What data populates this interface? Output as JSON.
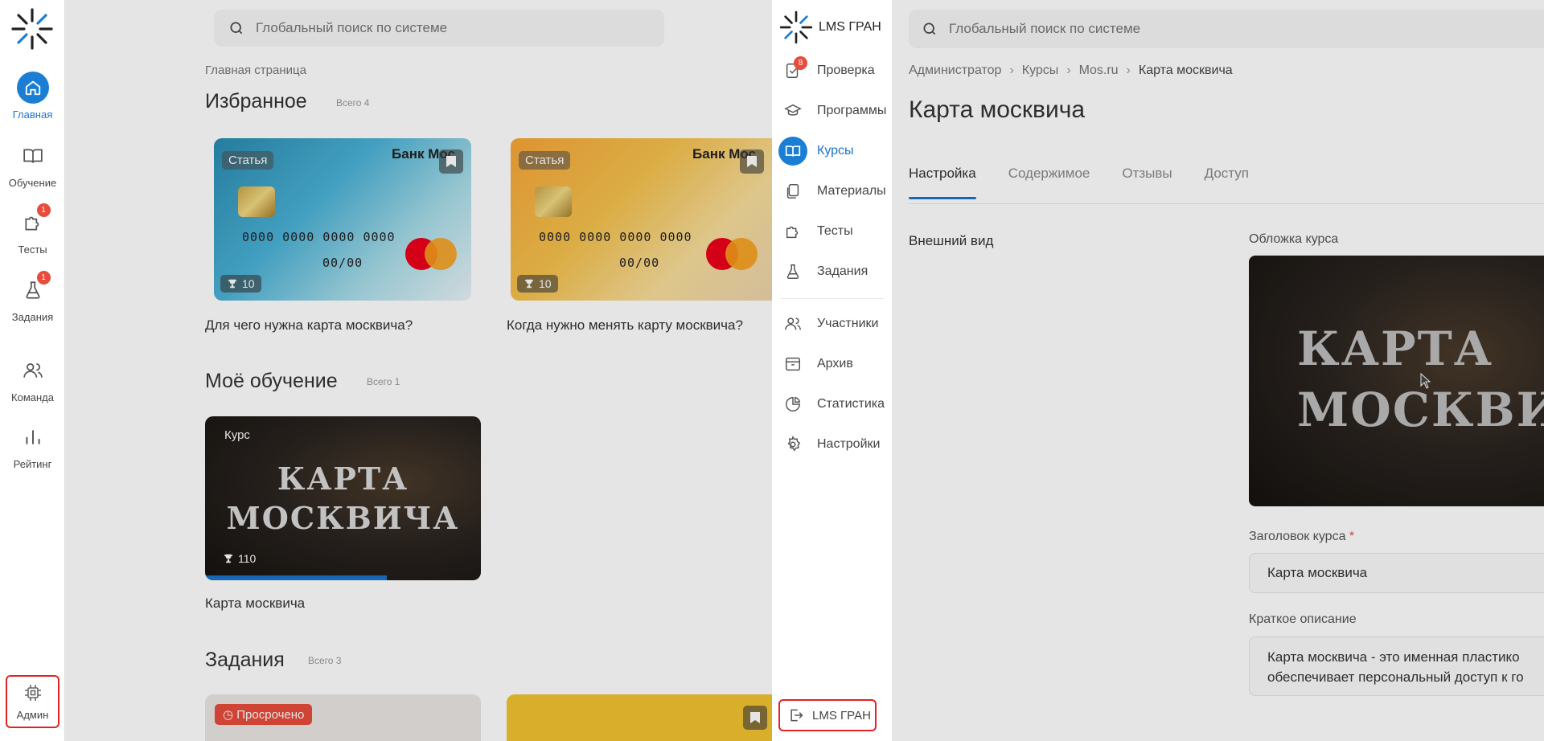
{
  "left": {
    "search_placeholder": "Глобальный поиск по системе",
    "breadcrumb": "Главная страница",
    "nav": [
      {
        "label": "Главная",
        "badge": ""
      },
      {
        "label": "Обучение",
        "badge": ""
      },
      {
        "label": "Тесты",
        "badge": "1"
      },
      {
        "label": "Задания",
        "badge": "1"
      },
      {
        "label": "Команда",
        "badge": ""
      },
      {
        "label": "Рейтинг",
        "badge": ""
      }
    ],
    "admin_label": "Админ",
    "favorites": {
      "title": "Избранное",
      "count": "Всего 4",
      "cards": [
        {
          "tag": "Статья",
          "score": "10",
          "caption": "Для чего нужна карта москвича?",
          "bank": "Банк Мос",
          "number": "0000 0000 0000 0000",
          "expiry": "00/00"
        },
        {
          "tag": "Статья",
          "score": "10",
          "caption": "Когда нужно менять карту москвича?",
          "bank": "Банк Мос",
          "number": "0000 0000 0000 0000",
          "expiry": "00/00"
        }
      ]
    },
    "learning": {
      "title": "Моё обучение",
      "count": "Всего 1",
      "card": {
        "tag": "Курс",
        "score": "110",
        "line1": "КАРТА",
        "line2": "МОСКВИЧА",
        "caption": "Карта москвича",
        "progress": 0.66
      }
    },
    "tasks": {
      "title": "Задания",
      "count": "Всего 3",
      "overdue": "Просрочено"
    }
  },
  "admin": {
    "brand": "LMS ГРАН",
    "nav": [
      {
        "label": "Проверка",
        "badge": "8"
      },
      {
        "label": "Программы",
        "badge": ""
      },
      {
        "label": "Курсы",
        "badge": ""
      },
      {
        "label": "Материалы",
        "badge": ""
      },
      {
        "label": "Тесты",
        "badge": ""
      },
      {
        "label": "Задания",
        "badge": ""
      },
      {
        "label": "Участники",
        "badge": ""
      },
      {
        "label": "Архив",
        "badge": ""
      },
      {
        "label": "Статистика",
        "badge": ""
      },
      {
        "label": "Настройки",
        "badge": ""
      }
    ],
    "exit_label": "LMS ГРАН",
    "search_placeholder": "Глобальный поиск по системе",
    "breadcrumbs": [
      "Администратор",
      "Курсы",
      "Mos.ru",
      "Карта москвича"
    ],
    "title": "Карта москвича",
    "tabs": [
      "Настройка",
      "Содержимое",
      "Отзывы",
      "Доступ"
    ],
    "section_label": "Внешний вид",
    "cover_label": "Обложка курса",
    "cover_line1": "КАРТА",
    "cover_line2": "МОСКВИ",
    "course_title_label": "Заголовок курса",
    "course_title_required": "*",
    "course_title_value": "Карта москвича",
    "short_desc_label": "Краткое описание",
    "short_desc_line1": "Карта москвича - это именная пластико",
    "short_desc_line2": "обеспечивает персональный доступ к го"
  },
  "colors": {
    "accent": "#1a73c9",
    "badge": "#e74c3c",
    "highlight": "#e02424"
  }
}
